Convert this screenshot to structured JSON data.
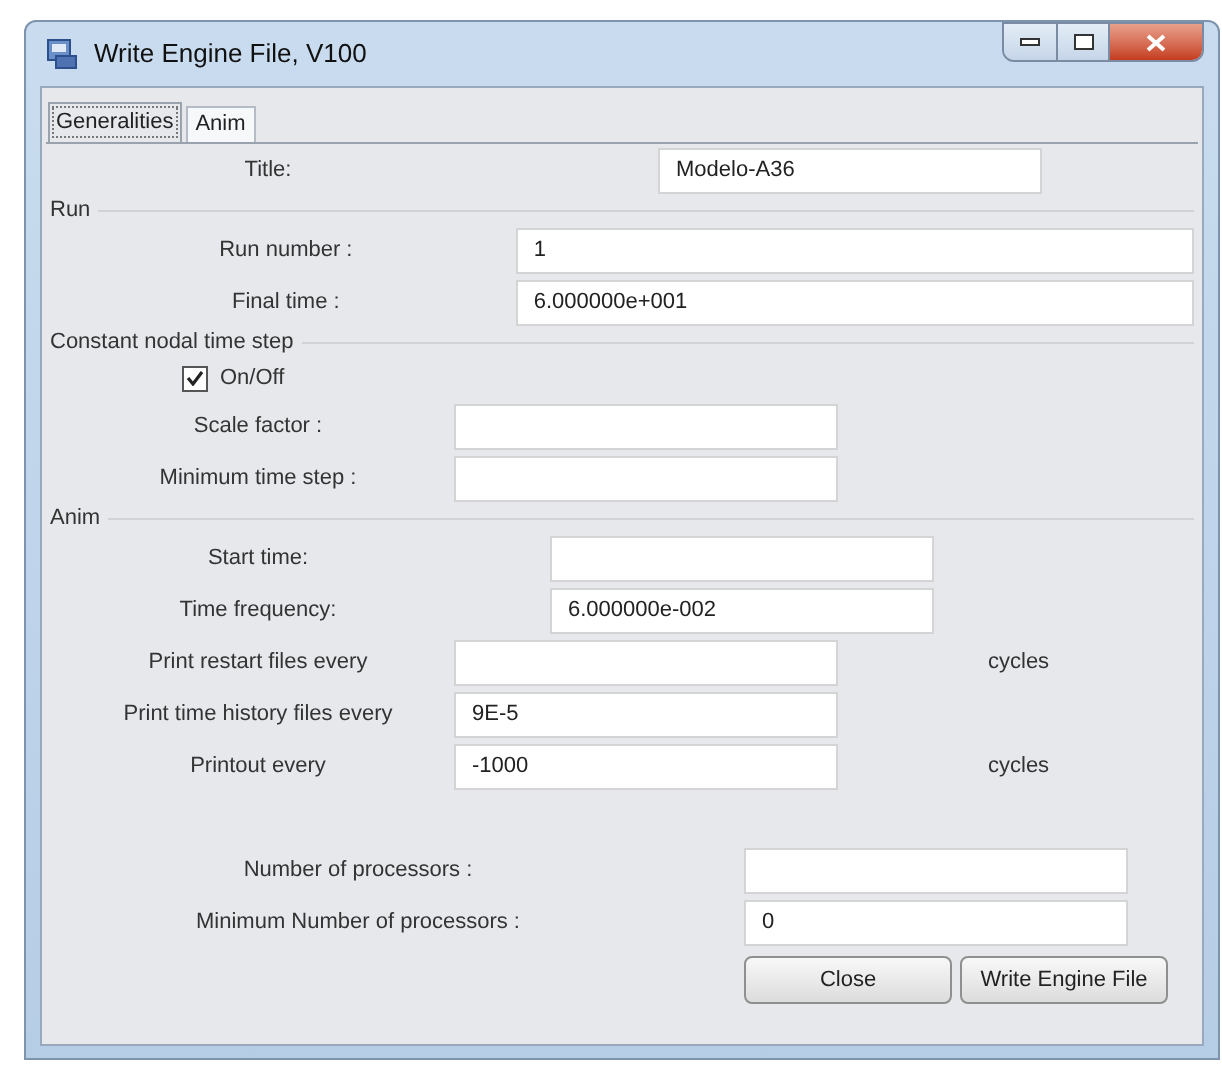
{
  "window": {
    "title": "Write Engine File, V100"
  },
  "tabs": [
    {
      "label": "Generalities",
      "selected": true
    },
    {
      "label": "Anim",
      "selected": false
    }
  ],
  "title_field": {
    "label": "Title:",
    "value": "Modelo-A36"
  },
  "run": {
    "heading": "Run",
    "fields": [
      {
        "label": "Run number :",
        "value": "1"
      },
      {
        "label": "Final time :",
        "value": "6.000000e+001"
      }
    ]
  },
  "constant_step": {
    "heading": "Constant nodal time step",
    "checkbox": {
      "label": "On/Off",
      "checked": true
    },
    "fields": [
      {
        "label": "Scale factor :"
      },
      {
        "label": "Minimum time step :"
      }
    ]
  },
  "anim": {
    "heading": "Anim",
    "fields": [
      {
        "label": "Start time:"
      },
      {
        "label": "Time frequency:",
        "value": "6.000000e-002"
      },
      {
        "label": "Print restart files every",
        "unit": "cycles"
      },
      {
        "label": "Print time history files every",
        "value": "9E-5"
      },
      {
        "label": "Printout every",
        "value": "-1000",
        "unit": "cycles"
      }
    ]
  },
  "processors": [
    {
      "label": "Number of processors :"
    },
    {
      "label": "Minimum Number of processors :",
      "value": "0"
    }
  ],
  "buttons": [
    "Close",
    "Write Engine File"
  ]
}
